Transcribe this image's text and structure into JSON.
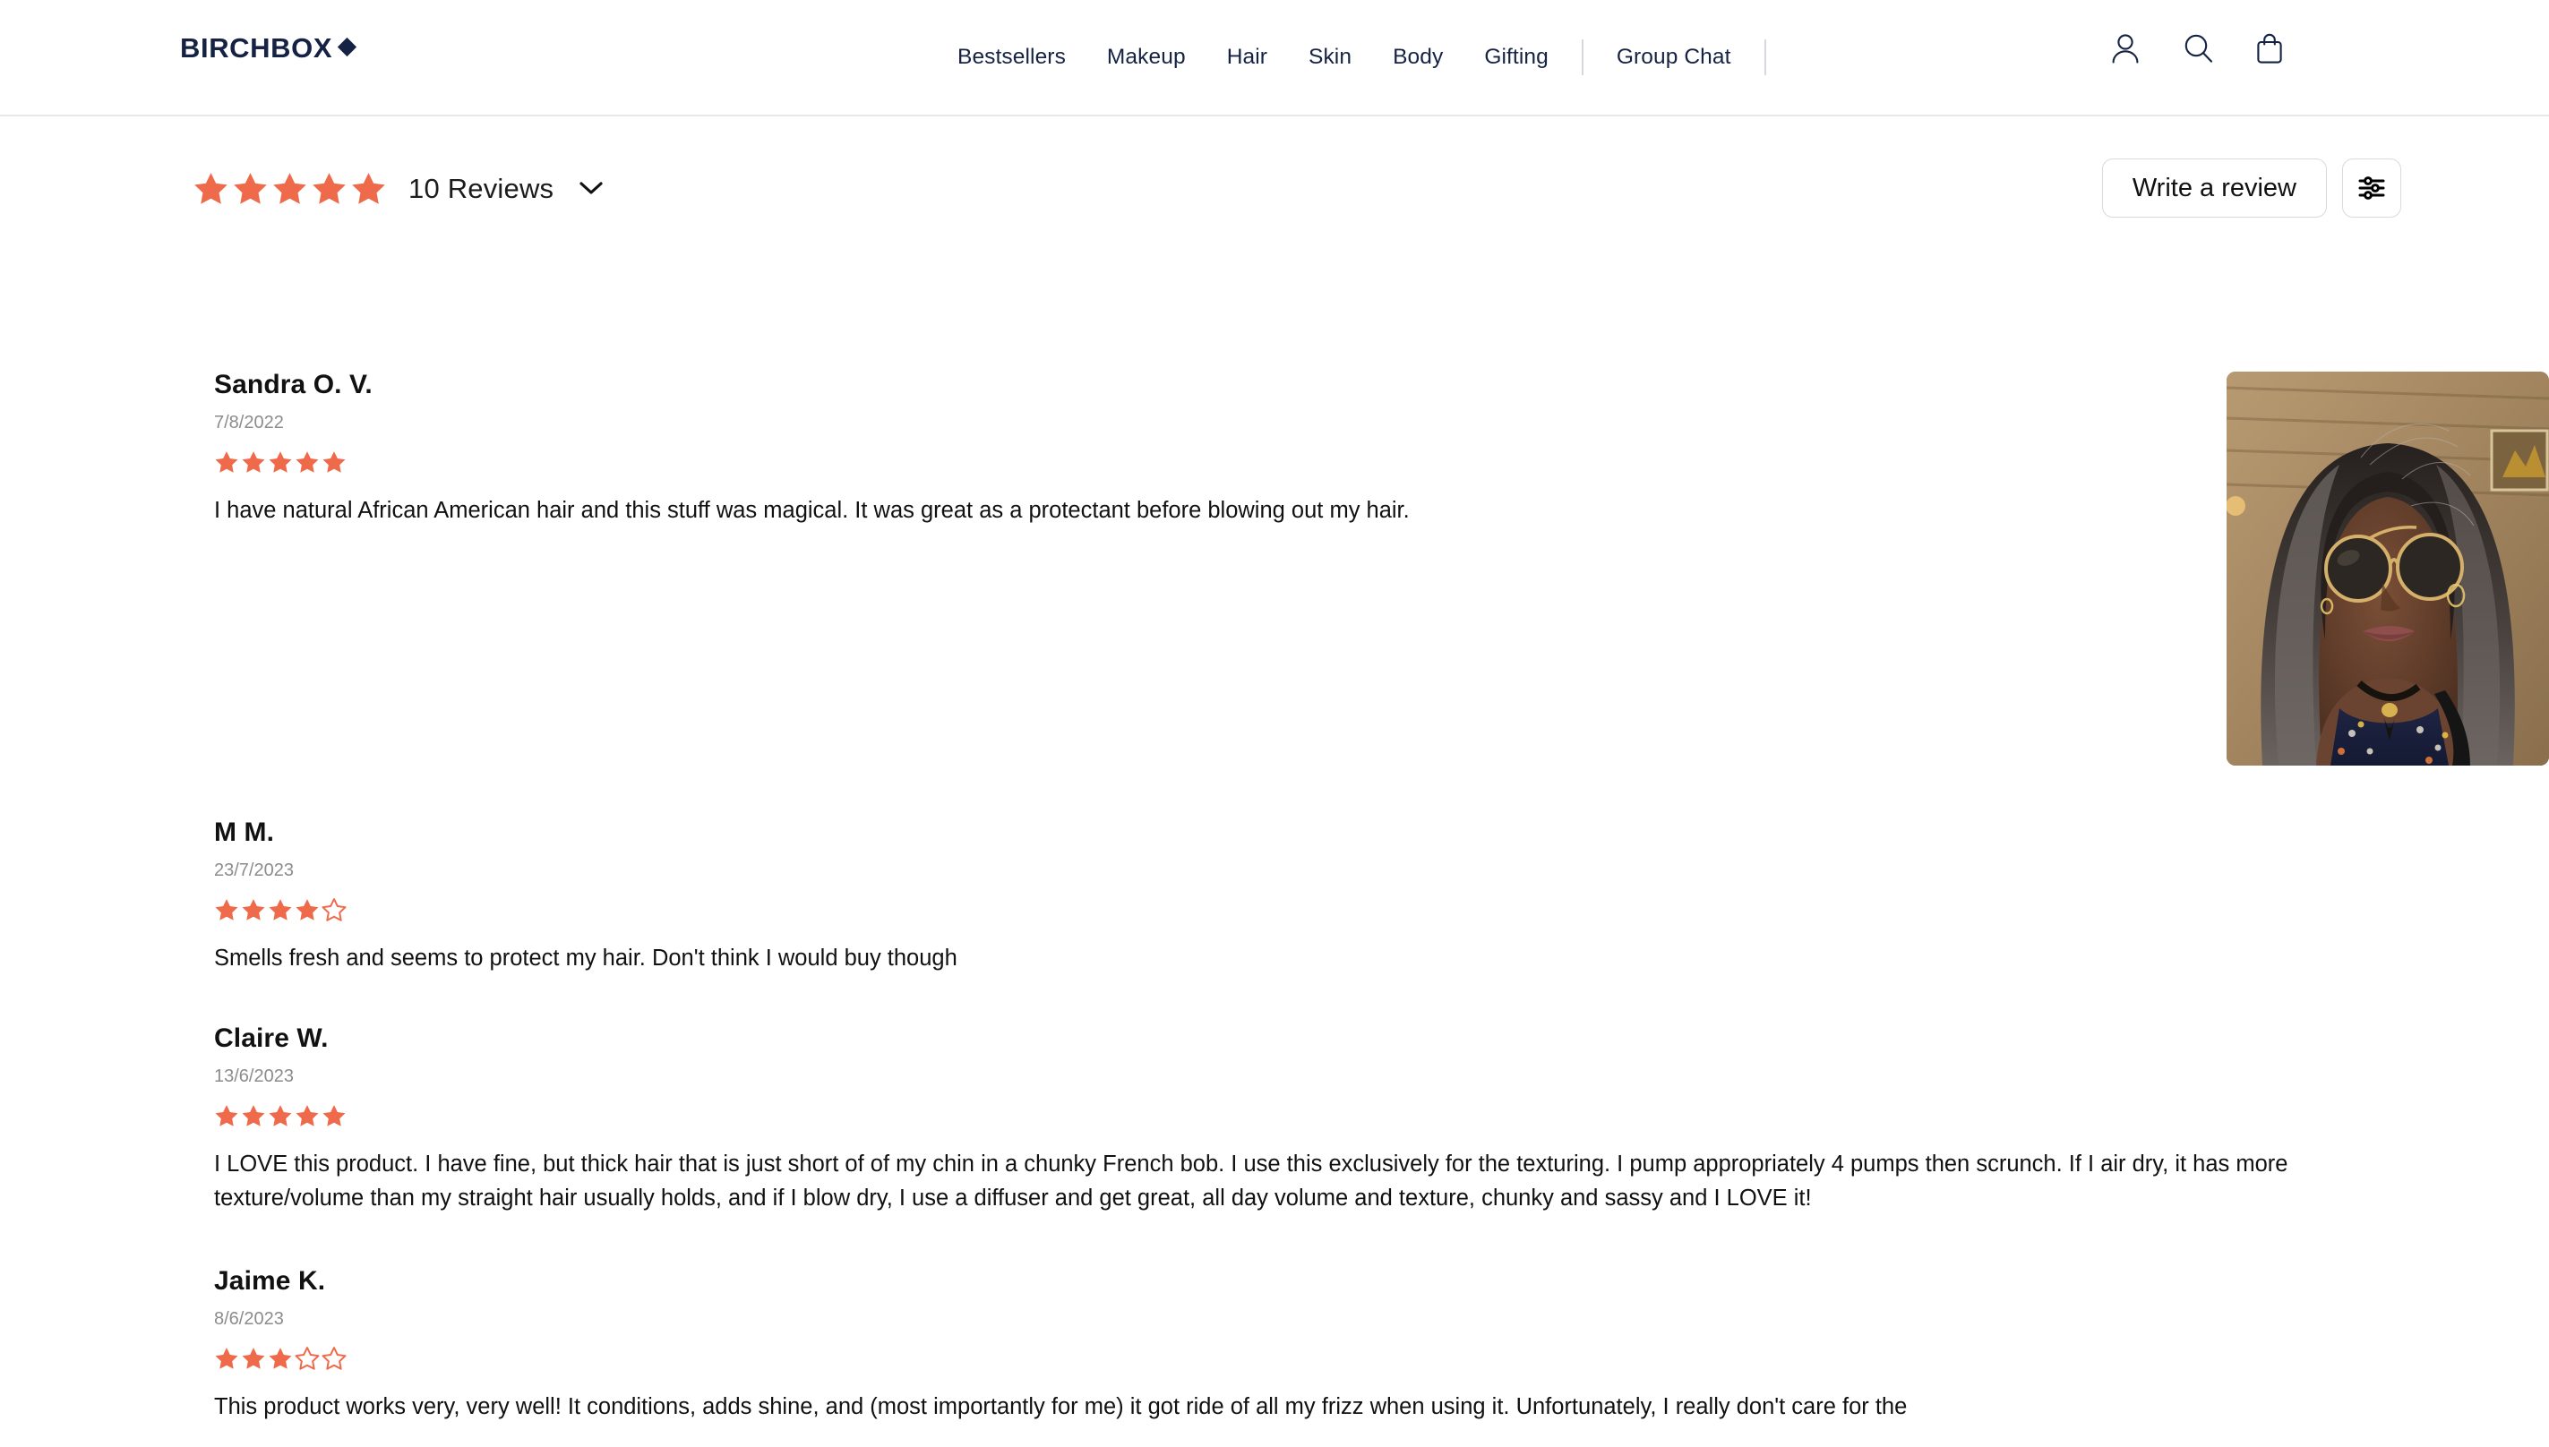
{
  "header": {
    "brand": "BIRCHBOX",
    "brand_icon": "diamond-icon",
    "nav": [
      {
        "label": "Bestsellers"
      },
      {
        "label": "Makeup"
      },
      {
        "label": "Hair"
      },
      {
        "label": "Skin"
      },
      {
        "label": "Body"
      },
      {
        "label": "Gifting"
      },
      {
        "label": "Group Chat"
      }
    ],
    "icons": [
      {
        "name": "account-icon"
      },
      {
        "name": "search-icon"
      },
      {
        "name": "shopping-bag-icon"
      }
    ],
    "brand_color": "#152244"
  },
  "reviews_header": {
    "average_stars": 5,
    "count_label": "10 Reviews",
    "expand_icon": "chevron-down-icon",
    "write_review_label": "Write a review",
    "filter_icon": "sliders-filter-icon",
    "star_color": "#EF6A4A"
  },
  "reviews": [
    {
      "name": "Sandra O. V.",
      "date": "7/8/2022",
      "rating": 5,
      "text": "I have natural African American hair and this stuff was magical. It was great as a protectant before blowing out my hair.",
      "has_photo": true,
      "photo_alt": "reviewer-photo"
    },
    {
      "name": "M M.",
      "date": "23/7/2023",
      "rating": 4,
      "text": "Smells fresh and seems to protect my hair. Don't think I would buy though",
      "has_photo": false
    },
    {
      "name": "Claire W.",
      "date": "13/6/2023",
      "rating": 5,
      "text": "I LOVE this product. I have fine, but thick hair that is just short of of my chin in a chunky French bob. I use this exclusively for the texturing. I pump appropriately 4 pumps then scrunch. If I air dry, it has more texture/volume than my straight hair usually holds, and if I blow dry, I use a diffuser and get great, all day volume and texture, chunky and sassy and I LOVE it!",
      "has_photo": false
    },
    {
      "name": "Jaime K.",
      "date": "8/6/2023",
      "rating": 3,
      "text": "This product works very, very well! It conditions, adds shine, and (most importantly for me) it got ride of all my frizz when using it. Unfortunately, I really don't care for the",
      "has_photo": false
    }
  ]
}
